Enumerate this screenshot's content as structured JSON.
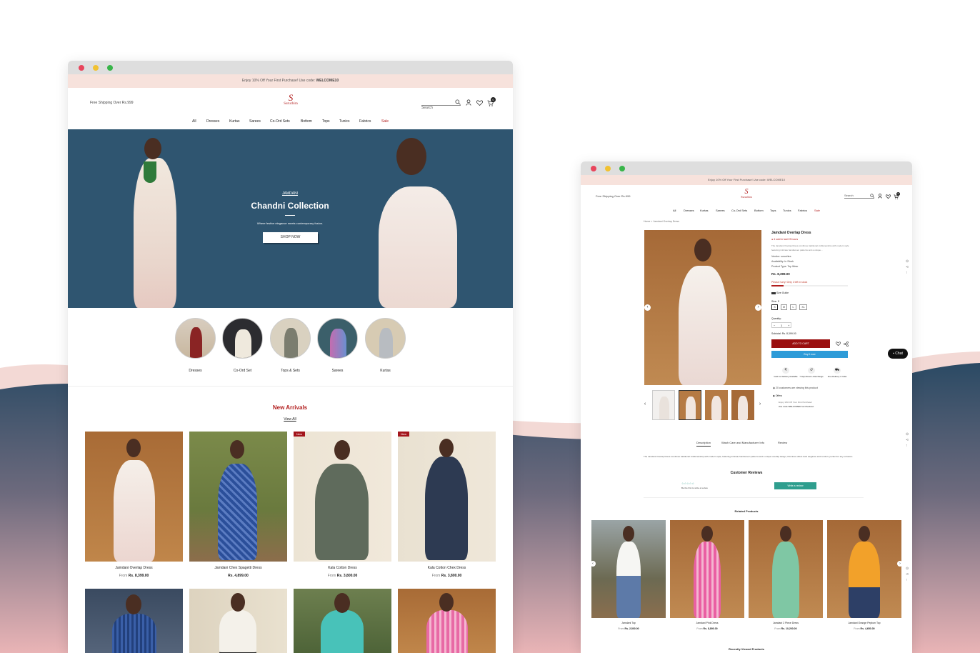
{
  "colors": {
    "accent": "#b21e1e",
    "hero_bg": "#2f5570",
    "wave_navy": "#2b4a64",
    "wave_pink": "#f3d9d5",
    "add_to_cart": "#9a0f0f",
    "buy_now": "#2d9bd8",
    "review_btn": "#2f9e8e",
    "promo_bg": "#f7e2dc"
  },
  "store": {
    "logo_text": "Suruchira",
    "logo_mark": "S"
  },
  "left": {
    "promo_prefix": "Enjoy 10% Off Your First Purchase! Use code: ",
    "promo_code": "WELCOME10",
    "shipping": "Free Shipping Over Rs.999",
    "search_placeholder": "Search",
    "cart_count": "0",
    "nav": [
      "All",
      "Dresses",
      "Kurtas",
      "Sarees",
      "Co-Ord Sets",
      "Bottom",
      "Tops",
      "Tunics",
      "Fabrics",
      "Sale"
    ],
    "hero": {
      "eyebrow": "JAMDANI",
      "title": "Chandni Collection",
      "subtitle": "Where festive elegance meets contemporary fusion.",
      "cta": "SHOP NOW"
    },
    "categories": [
      "Dresses",
      "Co-Ord Set",
      "Tops & Sets",
      "Sarees",
      "Kurtas"
    ],
    "section_title": "New Arrivals",
    "view_all": "View All",
    "products": [
      {
        "name": "Jamdani Overlap Dress",
        "from": "From",
        "price": "Rs. 8,399.00",
        "badge": ""
      },
      {
        "name": "Jamdani Chex Spagetti Dress",
        "from": "",
        "price": "Rs. 4,899.00",
        "badge": ""
      },
      {
        "name": "Kala Cotton Dress",
        "from": "From",
        "price": "Rs. 3,800.00",
        "badge": "New"
      },
      {
        "name": "Kala Cotton Chex Dress",
        "from": "From",
        "price": "Rs. 3,800.00",
        "badge": "New"
      }
    ]
  },
  "right": {
    "promo": "Enjoy 10% Off Your First Purchase! Use code: WELCOME10",
    "shipping": "Free Shipping Over Rs.999",
    "search_placeholder": "Search",
    "cart_count": "0",
    "nav": [
      "All",
      "Dresses",
      "Kurtas",
      "Sarees",
      "Co-Ord Sets",
      "Bottom",
      "Tops",
      "Tunics",
      "Fabrics",
      "Sale"
    ],
    "breadcrumb": "Home  >  Jamdani Overlap Dress",
    "product": {
      "title": "Jamdani Overlap Dress",
      "sold": "4 sold in last 23 hours",
      "desc_line1": "The Jamdani Overlap Dress combines traditional craftsmanship with modern style",
      "desc_line2": "featuring intricate handwoven patterns and a unique...",
      "vendor": "Vendor:   suruchira",
      "availability": "Availability:   In Stock",
      "type": "Product Type:   Top Wear",
      "price": "Rs. 8,399.00",
      "hurry": "Please hurry! Only 2 left in stock",
      "size_guide": "Size Guide",
      "size_label": "Size: S",
      "sizes": [
        "S",
        "M",
        "L",
        "XL"
      ],
      "quantity_label": "Quantity:",
      "quantity": "1",
      "subtotal": "Subtotal: Rs. 8,399.00",
      "add_to_cart": "ADD TO CART",
      "buy_now": "Buy it now",
      "features": [
        "Cash on Delivery Available",
        "7 days Return & Exchange",
        "Free Delivery in India"
      ],
      "viewing": "20 customers are viewing this product",
      "offers_title": "Offers",
      "offer_line1": "Enjoy 10% Off Your First Purchase!",
      "offer_line2": "Use code WELCOME10 at Checkout"
    },
    "tabs": [
      "Description",
      "Wash Care and Manufacturer Info",
      "Review"
    ],
    "description": "The Jamdani Overlap Dress combines traditional craftsmanship with modern style, featuring intricate handwoven patterns and a unique overlap design, this dress offers both elegance and comfort, perfect for any occasion.",
    "reviews_title": "Customer Reviews",
    "rating_stars": "☆☆☆☆☆",
    "review_prompt": "Be the first to write a review",
    "write_review": "Write a review",
    "related_title": "Related Products",
    "related": [
      {
        "name": "Jamdani Top",
        "from": "From",
        "price": "Rs. 2,500.00"
      },
      {
        "name": "Jamdani Pink Dress",
        "from": "From",
        "price": "Rs. 8,890.00"
      },
      {
        "name": "Jamdani 2 Piece Dress",
        "from": "From",
        "price": "Rs. 10,200.00"
      },
      {
        "name": "Jamdani Orange Peplum Top",
        "from": "From",
        "price": "Rs. 4,650.00"
      }
    ],
    "recently_viewed": "Recently Viewed Products",
    "chat": "Chat"
  }
}
